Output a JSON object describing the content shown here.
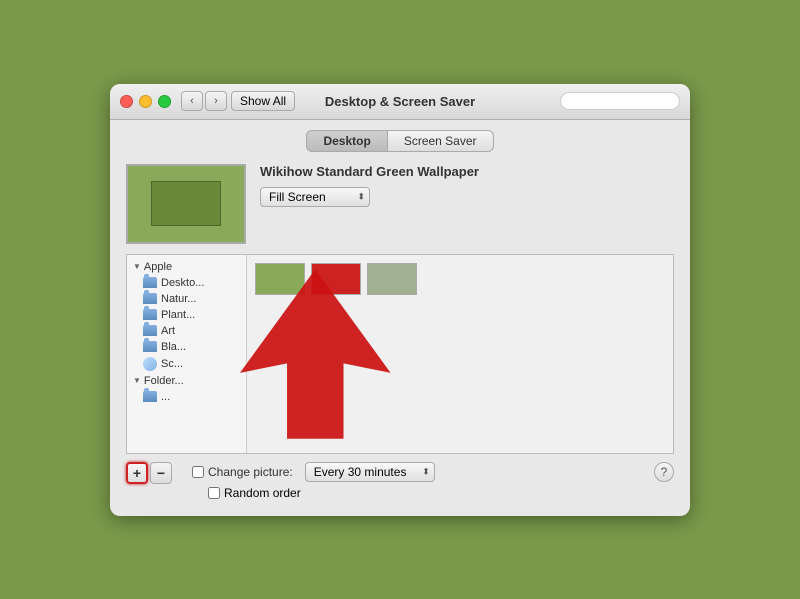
{
  "window": {
    "title": "Desktop & Screen Saver",
    "traffic_lights": [
      "close",
      "minimize",
      "maximize"
    ],
    "nav_back": "‹",
    "nav_forward": "›",
    "show_all_label": "Show All",
    "search_placeholder": ""
  },
  "tabs": [
    {
      "id": "desktop",
      "label": "Desktop",
      "active": true
    },
    {
      "id": "screensaver",
      "label": "Screen Saver",
      "active": false
    }
  ],
  "wallpaper": {
    "name": "Wikihow Standard Green Wallpaper",
    "fill_label": "Fill Screen",
    "dropdown_arrow": "⬍"
  },
  "sidebar": {
    "groups": [
      {
        "label": "Apple",
        "items": [
          "Desktop",
          "Natur...",
          "Plant...",
          "Art",
          "Bla...",
          "Sc..."
        ]
      },
      {
        "label": "Folder...",
        "items": [
          "..."
        ]
      }
    ]
  },
  "grid_items": [
    {
      "color": "green",
      "class": "wall-item-green"
    },
    {
      "color": "red",
      "class": "wall-item-red"
    },
    {
      "color": "sage",
      "class": "wall-item-sage"
    }
  ],
  "bottom_controls": {
    "add_label": "+",
    "remove_label": "−",
    "change_picture_checkbox": false,
    "change_picture_label": "Change picture:",
    "interval_label": "Every 30 minutes",
    "random_order_checkbox": false,
    "random_order_label": "Random order",
    "help_label": "?"
  }
}
